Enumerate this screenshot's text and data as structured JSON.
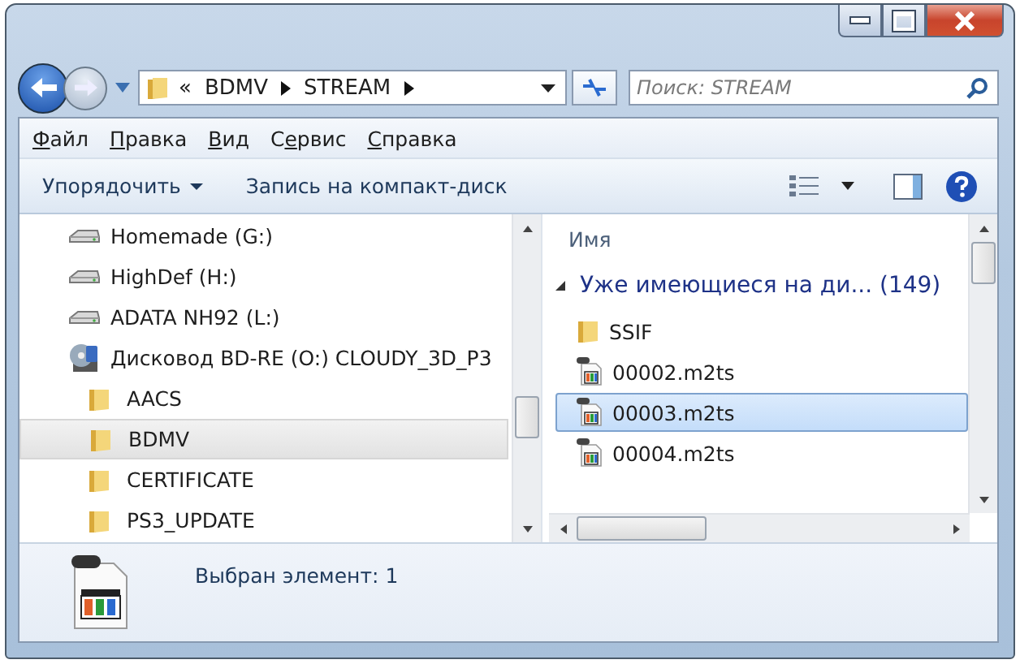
{
  "address": {
    "separator": "«",
    "crumbs": [
      "BDMV",
      "STREAM"
    ]
  },
  "search": {
    "placeholder": "Поиск: STREAM"
  },
  "menu": [
    {
      "key": "Ф",
      "after": "айл"
    },
    {
      "key": "П",
      "after": "равка"
    },
    {
      "key": "В",
      "after": "ид"
    },
    {
      "before": "С",
      "key": "е",
      "after": "рвис"
    },
    {
      "key": "С",
      "after": "правка"
    }
  ],
  "toolbar": [
    {
      "label": "Упорядочить",
      "dropdown": true
    },
    {
      "label": "Запись на компакт-диск",
      "dropdown": false
    }
  ],
  "tree": [
    {
      "label": "Homemade (G:)",
      "kind": "drive",
      "selected": false
    },
    {
      "label": "HighDef (H:)",
      "kind": "drive",
      "selected": false
    },
    {
      "label": "ADATA NH92 (L:)",
      "kind": "drive",
      "selected": false
    },
    {
      "label": "Дисковод BD-RE (O:) CLOUDY_3D_P3",
      "kind": "optical",
      "selected": false,
      "children": [
        {
          "label": "AACS",
          "kind": "folder",
          "selected": false
        },
        {
          "label": "BDMV",
          "kind": "folder",
          "selected": true
        },
        {
          "label": "CERTIFICATE",
          "kind": "folder",
          "selected": false
        },
        {
          "label": "PS3_UPDATE",
          "kind": "folder",
          "selected": false
        }
      ]
    }
  ],
  "list": {
    "column": "Имя",
    "group": {
      "label": "Уже имеющиеся на ди... (149)",
      "expanded": true
    },
    "items": [
      {
        "name": "SSIF",
        "kind": "folder",
        "selected": false
      },
      {
        "name": "00002.m2ts",
        "kind": "video",
        "selected": false
      },
      {
        "name": "00003.m2ts",
        "kind": "video",
        "selected": true
      },
      {
        "name": "00004.m2ts",
        "kind": "video",
        "selected": false
      }
    ]
  },
  "details": {
    "text": "Выбран элемент: 1"
  }
}
